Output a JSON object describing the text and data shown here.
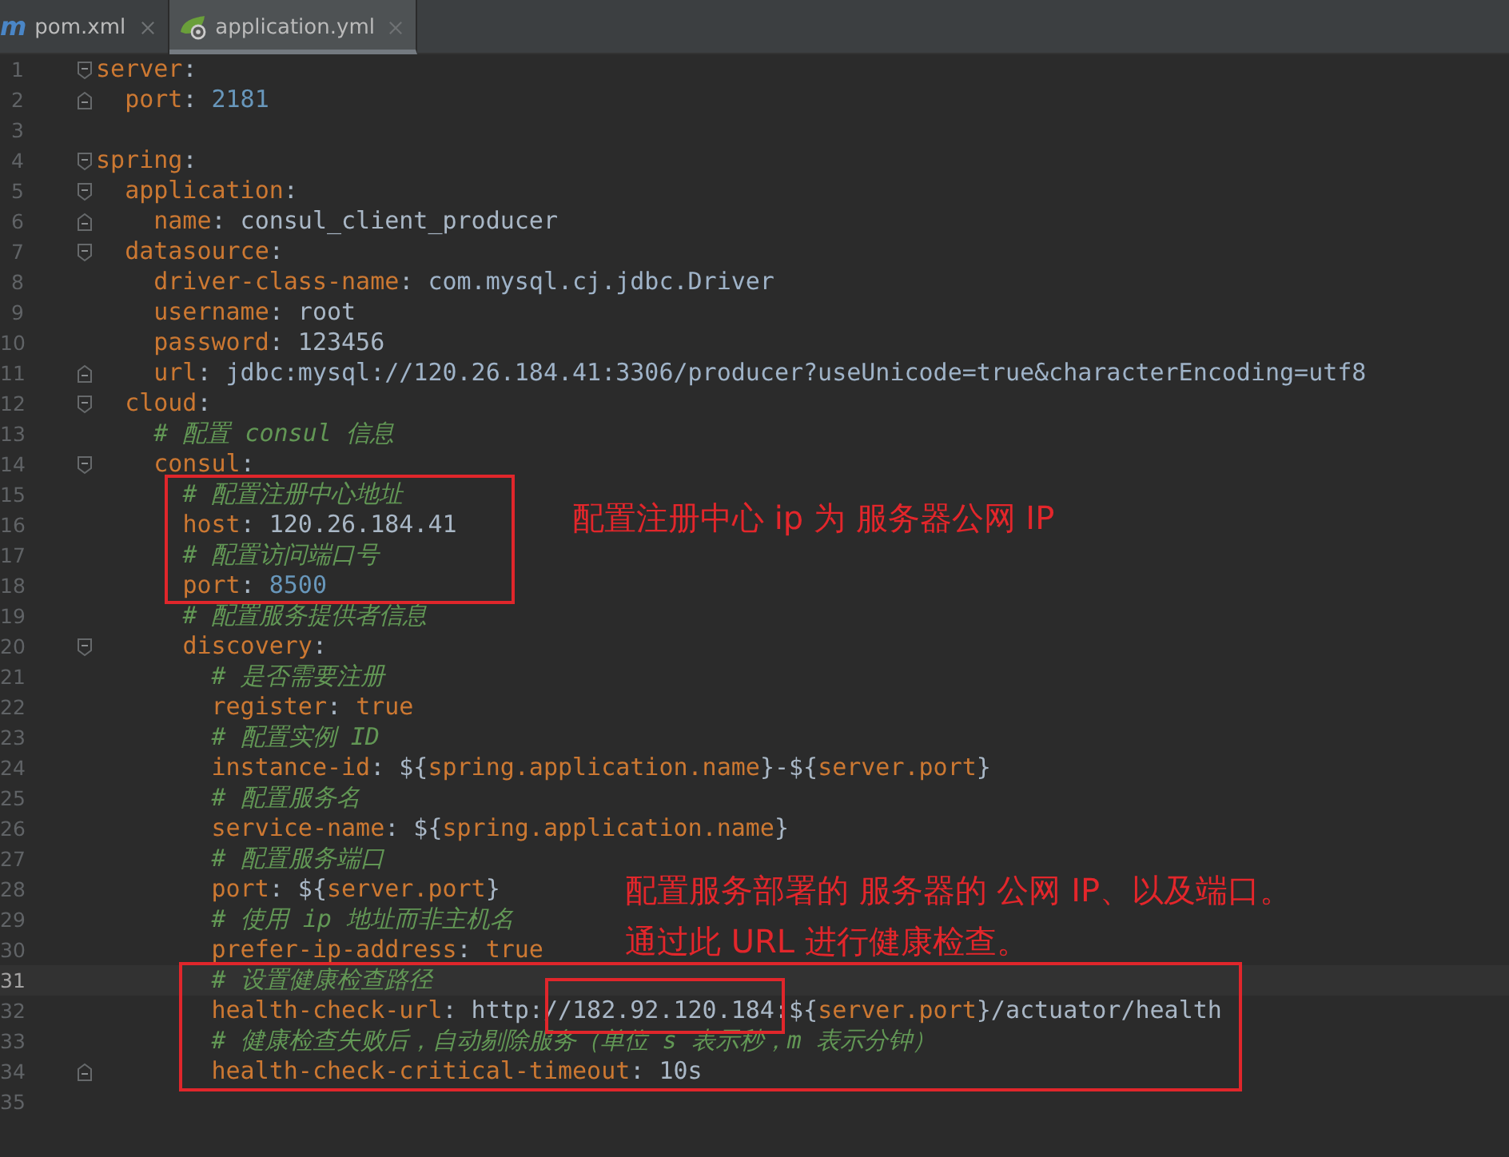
{
  "tabs": [
    {
      "label": "pom.xml",
      "icon_glyph": "m",
      "selected": false
    },
    {
      "label": "application.yml",
      "selected": true
    }
  ],
  "editor": {
    "lines": [
      {
        "number": "1",
        "fold_start": true,
        "current": false,
        "parts": [
          {
            "kind": "key",
            "text": "server"
          },
          {
            "kind": "plain",
            "text": ":"
          }
        ]
      },
      {
        "number": "2",
        "fold_end": true,
        "current": false,
        "parts": [
          {
            "kind": "key",
            "text": "  port"
          },
          {
            "kind": "plain",
            "text": ": "
          },
          {
            "kind": "number",
            "text": "2181"
          }
        ]
      },
      {
        "number": "3",
        "current": false
      },
      {
        "number": "4",
        "fold_start": true,
        "current": false,
        "parts": [
          {
            "kind": "key",
            "text": "spring"
          },
          {
            "kind": "plain",
            "text": ":"
          }
        ]
      },
      {
        "number": "5",
        "fold_start": true,
        "current": false,
        "parts": [
          {
            "kind": "key",
            "text": "  application"
          },
          {
            "kind": "plain",
            "text": ":"
          }
        ]
      },
      {
        "number": "6",
        "fold_end": true,
        "current": false,
        "parts": [
          {
            "kind": "key",
            "text": "    name"
          },
          {
            "kind": "plain",
            "text": ": consul_client_producer"
          }
        ]
      },
      {
        "number": "7",
        "fold_start": true,
        "current": false,
        "parts": [
          {
            "kind": "key",
            "text": "  datasource"
          },
          {
            "kind": "plain",
            "text": ":"
          }
        ]
      },
      {
        "number": "8",
        "current": false,
        "parts": [
          {
            "kind": "key",
            "text": "    driver-class-name"
          },
          {
            "kind": "plain",
            "text": ": "
          },
          {
            "kind": "value",
            "text": "com.mysql.cj.jdbc.Driver"
          }
        ]
      },
      {
        "number": "9",
        "current": false,
        "parts": [
          {
            "kind": "key",
            "text": "    username"
          },
          {
            "kind": "plain",
            "text": ": root"
          }
        ]
      },
      {
        "number": "10",
        "current": false,
        "parts": [
          {
            "kind": "key",
            "text": "    password"
          },
          {
            "kind": "plain",
            "text": ": 123456"
          }
        ]
      },
      {
        "number": "11",
        "fold_end": true,
        "current": false,
        "parts": [
          {
            "kind": "key",
            "text": "    url"
          },
          {
            "kind": "plain",
            "text": ": "
          },
          {
            "kind": "value",
            "text": "jdbc:mysql://120.26.184.41:3306/producer?useUnicode=true&characterEncoding=utf8"
          }
        ]
      },
      {
        "number": "12",
        "fold_start": true,
        "current": false,
        "parts": [
          {
            "kind": "key",
            "text": "  cloud"
          },
          {
            "kind": "plain",
            "text": ":"
          }
        ]
      },
      {
        "number": "13",
        "current": false,
        "parts": [
          {
            "kind": "comment",
            "text": "    # 配置 consul 信息"
          }
        ]
      },
      {
        "number": "14",
        "fold_start": true,
        "current": false,
        "parts": [
          {
            "kind": "key",
            "text": "    consul"
          },
          {
            "kind": "plain",
            "text": ":"
          }
        ]
      },
      {
        "number": "15",
        "current": false,
        "parts": [
          {
            "kind": "comment",
            "text": "      # 配置注册中心地址"
          }
        ]
      },
      {
        "number": "16",
        "current": false,
        "parts": [
          {
            "kind": "key",
            "text": "      host"
          },
          {
            "kind": "plain",
            "text": ": 120.26.184.41"
          }
        ]
      },
      {
        "number": "17",
        "current": false,
        "parts": [
          {
            "kind": "comment",
            "text": "      # 配置访问端口号"
          }
        ]
      },
      {
        "number": "18",
        "current": false,
        "parts": [
          {
            "kind": "key",
            "text": "      port"
          },
          {
            "kind": "plain",
            "text": ": "
          },
          {
            "kind": "number",
            "text": "8500"
          }
        ]
      },
      {
        "number": "19",
        "current": false,
        "parts": [
          {
            "kind": "comment",
            "text": "      # 配置服务提供者信息"
          }
        ]
      },
      {
        "number": "20",
        "fold_start": true,
        "current": false,
        "parts": [
          {
            "kind": "key",
            "text": "      discovery"
          },
          {
            "kind": "plain",
            "text": ":"
          }
        ]
      },
      {
        "number": "21",
        "current": false,
        "parts": [
          {
            "kind": "comment",
            "text": "        # 是否需要注册"
          }
        ]
      },
      {
        "number": "22",
        "current": false,
        "parts": [
          {
            "kind": "key",
            "text": "        register"
          },
          {
            "kind": "plain",
            "text": ": "
          },
          {
            "kind": "keyword",
            "text": "true"
          }
        ]
      },
      {
        "number": "23",
        "current": false,
        "parts": [
          {
            "kind": "comment",
            "text": "        # 配置实例 ID"
          }
        ]
      },
      {
        "number": "24",
        "current": false,
        "parts": [
          {
            "kind": "key",
            "text": "        instance-id"
          },
          {
            "kind": "plain",
            "text": ": ${"
          },
          {
            "kind": "keyword",
            "text": "spring.application.name"
          },
          {
            "kind": "plain",
            "text": "}-${"
          },
          {
            "kind": "keyword",
            "text": "server.port"
          },
          {
            "kind": "plain",
            "text": "}"
          }
        ]
      },
      {
        "number": "25",
        "current": false,
        "parts": [
          {
            "kind": "comment",
            "text": "        # 配置服务名"
          }
        ]
      },
      {
        "number": "26",
        "current": false,
        "parts": [
          {
            "kind": "key",
            "text": "        service-name"
          },
          {
            "kind": "plain",
            "text": ": ${"
          },
          {
            "kind": "keyword",
            "text": "spring.application.name"
          },
          {
            "kind": "plain",
            "text": "}"
          }
        ]
      },
      {
        "number": "27",
        "current": false,
        "parts": [
          {
            "kind": "comment",
            "text": "        # 配置服务端口"
          }
        ]
      },
      {
        "number": "28",
        "current": false,
        "parts": [
          {
            "kind": "key",
            "text": "        port"
          },
          {
            "kind": "plain",
            "text": ": ${"
          },
          {
            "kind": "keyword",
            "text": "server.port"
          },
          {
            "kind": "plain",
            "text": "}"
          }
        ]
      },
      {
        "number": "29",
        "current": false,
        "parts": [
          {
            "kind": "comment",
            "text": "        # 使用 ip 地址而非主机名"
          }
        ]
      },
      {
        "number": "30",
        "current": false,
        "parts": [
          {
            "kind": "key",
            "text": "        prefer-ip-address"
          },
          {
            "kind": "plain",
            "text": ": "
          },
          {
            "kind": "keyword",
            "text": "true"
          }
        ]
      },
      {
        "number": "31",
        "current": true,
        "parts": [
          {
            "kind": "comment",
            "text": "        # 设置健康检查路径"
          }
        ]
      },
      {
        "number": "32",
        "current": false,
        "parts": [
          {
            "kind": "key",
            "text": "        health-check-url"
          },
          {
            "kind": "plain",
            "text": ": http:/"
          },
          {
            "kind": "plain",
            "text": "/182.92.120.184"
          },
          {
            "kind": "plain",
            "text": ":${"
          },
          {
            "kind": "keyword",
            "text": "server.port"
          },
          {
            "kind": "plain",
            "text": "}/actuator/health"
          }
        ]
      },
      {
        "number": "33",
        "current": false,
        "parts": [
          {
            "kind": "comment",
            "text": "        # 健康检查失败后，自动剔除服务（单位 s 表示秒，m 表示分钟）"
          }
        ]
      },
      {
        "number": "34",
        "fold_end": true,
        "current": false,
        "parts": [
          {
            "kind": "key",
            "text": "        health-check-critical-timeout"
          },
          {
            "kind": "plain",
            "text": ": 10s"
          }
        ]
      },
      {
        "number": "35",
        "current": false
      }
    ]
  },
  "annotations": [
    {
      "kind": "registry",
      "lines": [
        "配置注册中心 ip 为 服务器公网 IP"
      ]
    },
    {
      "kind": "health",
      "lines": [
        "配置服务部署的 服务器的 公网 IP、以及端口。",
        "通过此 URL 进行健康检查。"
      ]
    }
  ]
}
